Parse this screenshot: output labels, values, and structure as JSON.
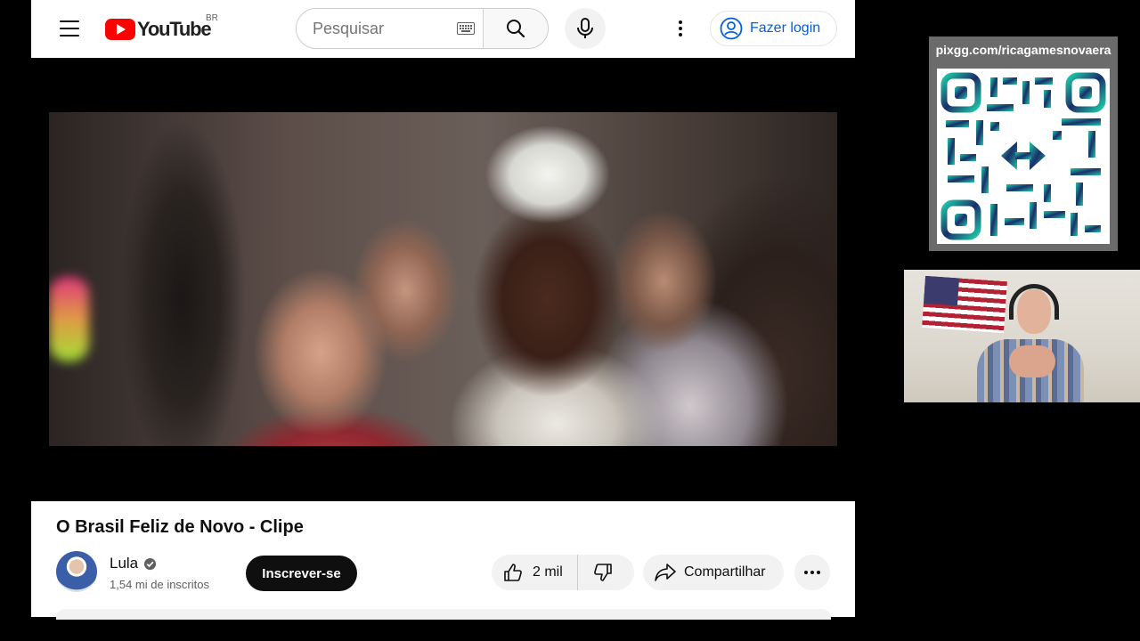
{
  "header": {
    "logo_text": "YouTube",
    "country_code": "BR",
    "search_placeholder": "Pesquisar",
    "login_label": "Fazer login"
  },
  "video": {
    "title": "O Brasil Feliz de Novo - Clipe"
  },
  "channel": {
    "name": "Lula",
    "subscribers": "1,54 mi de inscritos",
    "subscribe_label": "Inscrever-se"
  },
  "actions": {
    "like_count": "2 mil",
    "share_label": "Compartilhar"
  },
  "overlay": {
    "qr_url": "pixgg.com/ricagamesnovaera"
  },
  "colors": {
    "brand_red": "#ff0000",
    "link_blue": "#065fd4",
    "qr_teal": "#1fc9a6"
  }
}
